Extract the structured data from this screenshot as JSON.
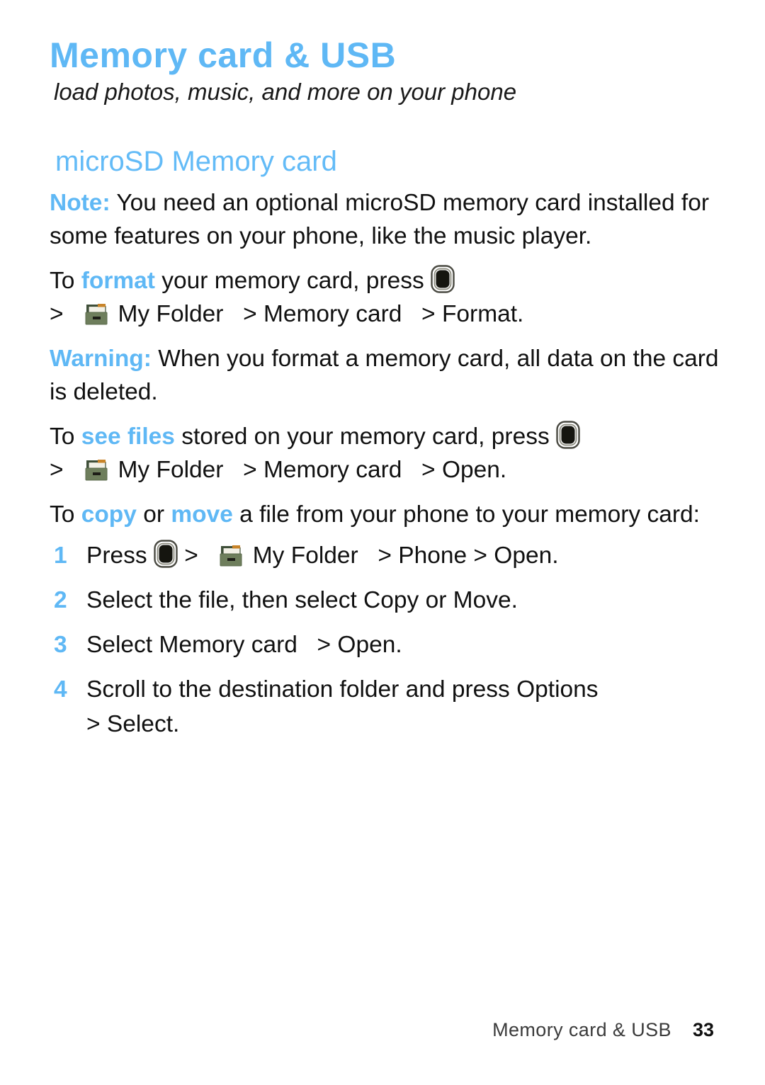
{
  "chapter": {
    "title": "Memory card & USB",
    "subtitle": "load photos, music, and more on your phone"
  },
  "section": {
    "heading": "microSD Memory card"
  },
  "note": {
    "label": "Note:",
    "text": "You need an optional microSD memory card installed for some features on your phone, like the music player."
  },
  "format_instruction": {
    "prefix": "To",
    "highlight": "format",
    "middle": "your memory card, press",
    "arrow1": ">",
    "my_folder": "My Folder",
    "arrow2": ">",
    "memory_card": "Memory card",
    "arrow3": ">",
    "action": "Format",
    "period": "."
  },
  "warning": {
    "label": "Warning:",
    "text": "When you format a memory card, all data on the card is deleted."
  },
  "see_files_instruction": {
    "prefix": "To",
    "highlight": "see files",
    "middle": "stored on your memory card, press",
    "arrow1": ">",
    "my_folder": "My Folder",
    "arrow2": ">",
    "memory_card": "Memory card",
    "arrow3": ">",
    "action": "Open",
    "period": "."
  },
  "copy_move_intro": {
    "prefix": "To",
    "highlight1": "copy",
    "conjunction": "or",
    "highlight2": "move",
    "suffix": "a file from your phone to your memory card:"
  },
  "steps": [
    {
      "num": "1",
      "press": "Press",
      "arrow1": ">",
      "my_folder": "My Folder",
      "arrow2": ">",
      "target": "Phone",
      "arrow3": ">",
      "action": "Open",
      "period": "."
    },
    {
      "num": "2",
      "text": "Select the file, then select Copy or Move",
      "period": "."
    },
    {
      "num": "3",
      "text": "Select Memory card",
      "arrow": ">",
      "action": "Open",
      "period": "."
    },
    {
      "num": "4",
      "text": "Scroll to the destination folder and press Options",
      "arrow": ">",
      "action": "Select",
      "period": "."
    }
  ],
  "footer": {
    "title": "Memory card & USB",
    "page": "33"
  },
  "colors": {
    "accent_blue": "#5FB8F5",
    "heading_blue": "#63BBF7",
    "body_text": "#111111",
    "folder_green_front": "#6E7E5C",
    "folder_green_back": "#3F4F39",
    "folder_tab_orange": "#C8842A"
  },
  "icons": {
    "center_key": "center-key-icon",
    "my_folder": "file-box-icon"
  }
}
